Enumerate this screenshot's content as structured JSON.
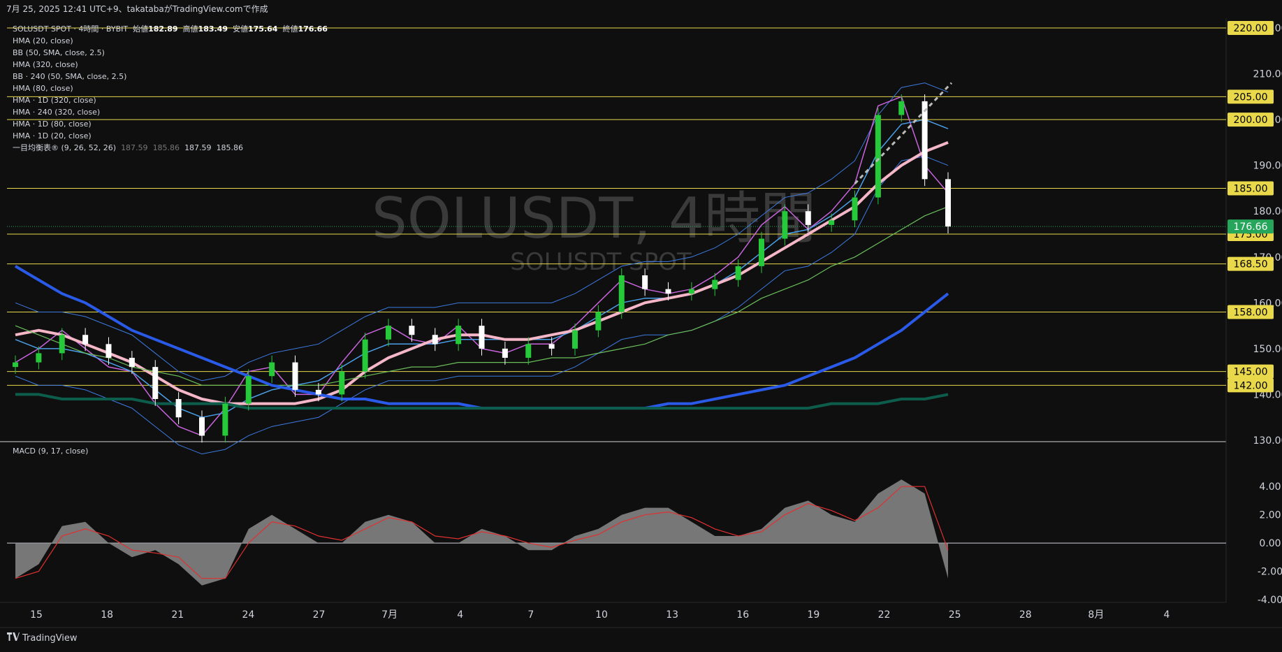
{
  "header": {
    "caption": "7月 25, 2025 12:41 UTC+9、takatabaがTradingView.comで作成"
  },
  "legend": {
    "symbol": "SOLUSDT SPOT · 4時間 · BYBIT",
    "ohlc": [
      {
        "label": "始値",
        "value": "182.89"
      },
      {
        "label": "高値",
        "value": "183.49"
      },
      {
        "label": "安値",
        "value": "175.64"
      },
      {
        "label": "終値",
        "value": "176.66"
      }
    ],
    "indicators": [
      "HMA (20, close)",
      "BB (50, SMA, close, 2.5)",
      "HMA (320, close)",
      "BB · 240 (50, SMA, close, 2.5)",
      "HMA (80, close)",
      "HMA · 1D (320, close)",
      "HMA · 240 (320, close)",
      "HMA · 1D (80, close)",
      "HMA · 1D (20, close)"
    ],
    "ichimoku": {
      "label": "一目均衡表® (9, 26, 52, 26)",
      "values": [
        "187.59",
        "185.86",
        "187.59",
        "185.86"
      ]
    }
  },
  "watermark": {
    "title": "SOLUSDT, 4時間",
    "subtitle": "SOLUSDT SPOT"
  },
  "macd_label": "MACD (9, 17, close)",
  "footer": {
    "brand": "TradingView",
    "logo_icon": "tradingview-logo-icon"
  },
  "colors": {
    "up": "#26c93a",
    "down": "#ffffff",
    "hma20": "#c864dc",
    "hma80": "#4a9fe8",
    "hma320": "#2a5ae8",
    "hma1d80": "#6abf5a",
    "hma1d320": "#0d5d4c",
    "hma1d20": "#f5b7c8",
    "bb": "#3c7ae0",
    "level": "#e8d84a",
    "price_tag": "#26a65b",
    "macd_hist": "#8a8a8a",
    "macd_signal": "#e03030"
  },
  "chart_data": {
    "type": "line",
    "symbol": "SOLUSDT",
    "timeframe": "4時間",
    "price_axis": {
      "ticks": [
        "220.00",
        "210.00",
        "200.00",
        "190.00",
        "180.00",
        "170.00",
        "160.00",
        "150.00",
        "140.00",
        "130.00"
      ],
      "range": [
        130,
        220
      ]
    },
    "time_axis": {
      "ticks": [
        "15",
        "18",
        "21",
        "24",
        "27",
        "7月",
        "4",
        "7",
        "10",
        "13",
        "16",
        "19",
        "22",
        "25",
        "28",
        "8月",
        "4"
      ]
    },
    "levels": [
      "220.00",
      "205.00",
      "200.00",
      "185.00",
      "175.00",
      "168.50",
      "158.00",
      "145.00",
      "142.00"
    ],
    "last_price": "176.66",
    "candles_x": [
      "15",
      "16",
      "17",
      "18",
      "19",
      "20",
      "21",
      "22",
      "23",
      "24",
      "25",
      "26",
      "27",
      "28",
      "29",
      "30",
      "7月",
      "2",
      "3",
      "4",
      "5",
      "6",
      "7",
      "8",
      "9",
      "10",
      "11",
      "12",
      "13",
      "14",
      "15",
      "16",
      "17",
      "18",
      "19",
      "20",
      "21",
      "22",
      "23",
      "24",
      "25"
    ],
    "close": [
      147,
      149,
      153,
      151,
      148,
      146,
      139,
      135,
      131,
      138,
      144,
      147,
      141,
      140,
      145,
      152,
      155,
      153,
      151,
      155,
      150,
      148,
      151,
      150,
      154,
      158,
      166,
      163,
      162,
      163,
      165,
      168,
      174,
      180,
      177,
      178,
      183,
      201,
      204,
      187,
      176.66
    ],
    "series": [
      {
        "name": "HMA (20, close)",
        "values": [
          147,
          150,
          154,
          150,
          146,
          145,
          138,
          133,
          131,
          137,
          145,
          146,
          140,
          140,
          147,
          153,
          155,
          152,
          151,
          155,
          150,
          149,
          151,
          151,
          155,
          160,
          165,
          163,
          162,
          163,
          166,
          170,
          177,
          181,
          176,
          180,
          186,
          203,
          205,
          190,
          184
        ]
      },
      {
        "name": "HMA (80, close)",
        "values": [
          152,
          150,
          150,
          149,
          147,
          145,
          141,
          137,
          135,
          136,
          139,
          141,
          142,
          143,
          146,
          149,
          151,
          151,
          151,
          152,
          152,
          152,
          152,
          152,
          154,
          157,
          160,
          161,
          161,
          162,
          164,
          167,
          171,
          175,
          176,
          179,
          183,
          193,
          199,
          200,
          198
        ]
      },
      {
        "name": "HMA · 1D (20, close)",
        "values": [
          153,
          154,
          153,
          151,
          149,
          147,
          144,
          141,
          139,
          138,
          138,
          138,
          138,
          139,
          141,
          145,
          148,
          150,
          152,
          153,
          153,
          152,
          152,
          153,
          154,
          156,
          158,
          160,
          161,
          162,
          164,
          166,
          169,
          172,
          175,
          178,
          181,
          186,
          190,
          193,
          195
        ]
      },
      {
        "name": "HMA · 1D (80, close)",
        "values": [
          155,
          153,
          151,
          149,
          148,
          146,
          145,
          144,
          142,
          142,
          142,
          142,
          142,
          142,
          143,
          144,
          145,
          146,
          146,
          147,
          147,
          147,
          147,
          148,
          148,
          149,
          150,
          151,
          153,
          154,
          156,
          158,
          161,
          163,
          165,
          168,
          170,
          173,
          176,
          179,
          181
        ]
      },
      {
        "name": "HMA (320, close)",
        "values": [
          168,
          165,
          162,
          160,
          157,
          154,
          152,
          150,
          148,
          146,
          144,
          142,
          141,
          140,
          139,
          139,
          138,
          138,
          138,
          138,
          137,
          137,
          137,
          137,
          137,
          137,
          137,
          137,
          138,
          138,
          139,
          140,
          141,
          142,
          144,
          146,
          148,
          151,
          154,
          158,
          162
        ]
      },
      {
        "name": "HMA · 1D (320, close)",
        "values": [
          140,
          140,
          139,
          139,
          139,
          139,
          138,
          138,
          138,
          138,
          137,
          137,
          137,
          137,
          137,
          137,
          137,
          137,
          137,
          137,
          137,
          137,
          137,
          137,
          137,
          137,
          137,
          137,
          137,
          137,
          137,
          137,
          137,
          137,
          137,
          138,
          138,
          138,
          139,
          139,
          140
        ]
      }
    ],
    "macd": {
      "ticks": [
        "4.00",
        "2.00",
        "0.00",
        "-2.00",
        "-4.00"
      ],
      "range": [
        -4,
        5
      ],
      "values": [
        -2.5,
        -1.5,
        1.2,
        1.5,
        0,
        -1,
        -0.5,
        -1.5,
        -3,
        -2.5,
        1,
        2,
        1,
        0,
        0,
        1.5,
        2,
        1.5,
        0,
        0,
        1,
        0.5,
        -0.5,
        -0.5,
        0.5,
        1,
        2,
        2.5,
        2.5,
        1.5,
        0.5,
        0.5,
        1,
        2.5,
        3,
        2,
        1.5,
        3.5,
        4.5,
        3.5,
        -2.5
      ],
      "signal": [
        -2.5,
        -2,
        0.5,
        1,
        0.5,
        -0.5,
        -0.7,
        -1,
        -2.5,
        -2.5,
        0,
        1.5,
        1.2,
        0.5,
        0.2,
        1,
        1.8,
        1.5,
        0.5,
        0.3,
        0.8,
        0.5,
        0,
        -0.3,
        0.2,
        0.6,
        1.5,
        2,
        2.2,
        1.8,
        1,
        0.5,
        0.8,
        2,
        2.8,
        2.3,
        1.6,
        2.5,
        4,
        4,
        -0.5
      ]
    }
  }
}
